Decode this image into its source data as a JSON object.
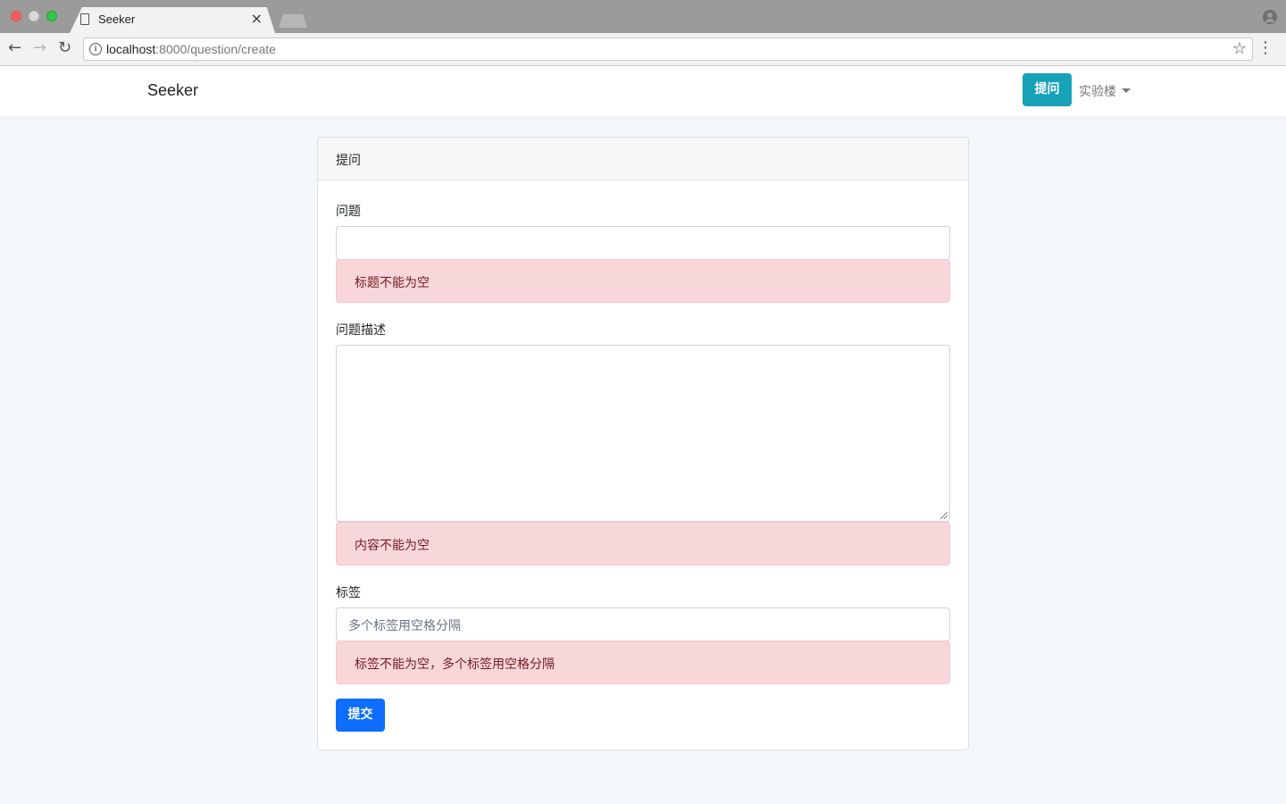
{
  "browser": {
    "tab_title": "Seeker",
    "tab_close": "×",
    "url_host": "localhost",
    "url_path": ":8000/question/create",
    "back_glyph": "←",
    "forward_glyph": "→",
    "reload_glyph": "↻",
    "star_glyph": "☆",
    "menu_glyph": "⋮",
    "info_glyph": "i"
  },
  "navbar": {
    "brand": "Seeker",
    "ask_button": "提问",
    "user_menu": "实验楼"
  },
  "form": {
    "header": "提问",
    "title_label": "问题",
    "title_value": "",
    "title_error": "标题不能为空",
    "body_label": "问题描述",
    "body_value": "",
    "body_error": "内容不能为空",
    "tags_label": "标签",
    "tags_placeholder": "多个标签用空格分隔",
    "tags_error": "标签不能为空，多个标签用空格分隔",
    "submit": "提交"
  },
  "colors": {
    "ask_button": "#17a2b8",
    "submit_button": "#0d6efd",
    "alert_bg": "#f8d7da",
    "alert_text": "#721c24"
  }
}
